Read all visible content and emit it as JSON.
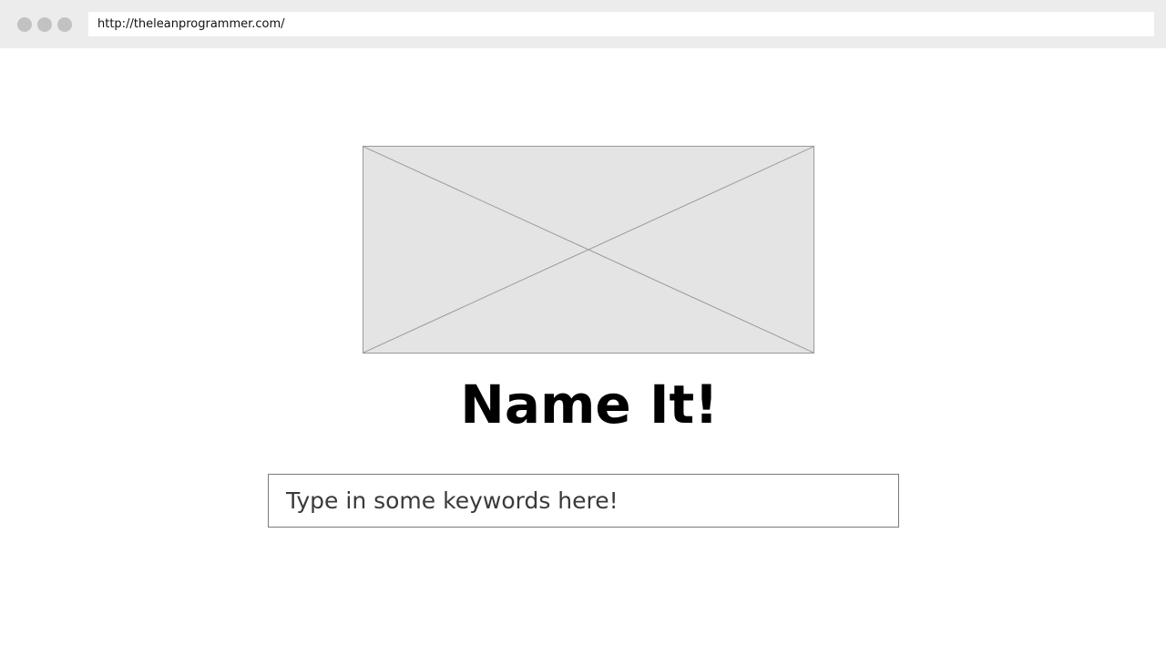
{
  "browser": {
    "url": "http://theleanprogrammer.com/",
    "window_controls": [
      "close-dot",
      "minimize-dot",
      "maximize-dot"
    ]
  },
  "main": {
    "image_placeholder_icon": "image-placeholder-icon",
    "title": "Name It!",
    "search": {
      "value": "",
      "placeholder": "Type in some keywords here!"
    }
  },
  "colors": {
    "browser_bar": "#ececec",
    "window_dot": "#c2c2c2",
    "image_fill": "#e4e4e4",
    "image_border": "#9a9a9a",
    "input_border": "#7a7a7a",
    "title": "#000000"
  }
}
